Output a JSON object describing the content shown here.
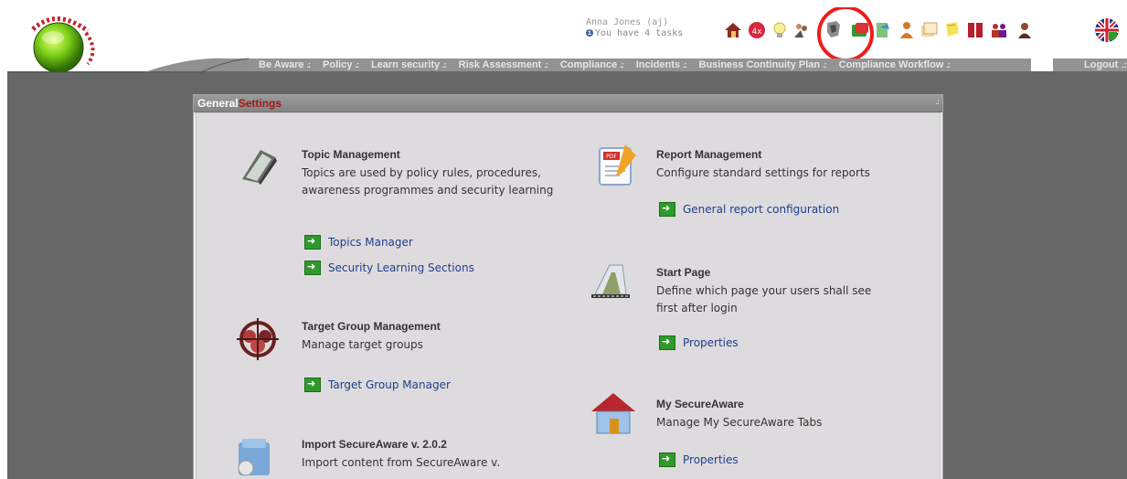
{
  "user": {
    "name": "Anna Jones (aj)",
    "tasks": "You have 4 tasks"
  },
  "toolbar_icons": [
    "house-icon",
    "alert-icon",
    "lightbulb-icon",
    "users-icon",
    "shield-icon",
    "folder-icon",
    "document-icon",
    "person-icon",
    "files-icon",
    "note-icon",
    "book-icon",
    "group-icon",
    "person-dark-icon"
  ],
  "nav": {
    "items": [
      "Be Aware",
      "Policy",
      "Learn security",
      "Risk Assessment",
      "Compliance",
      "Incidents",
      "Business Continuity Plan",
      "Compliance Workflow"
    ],
    "separator": ".:",
    "logout": "Logout"
  },
  "panel": {
    "title_prefix": "General",
    "title_accent": "Settings",
    "resize": ".:"
  },
  "sections": {
    "topic": {
      "title": "Topic Management",
      "desc": "Topics are used by policy rules, procedures, awareness programmes and security learning",
      "links": [
        "Topics Manager",
        "Security Learning Sections"
      ]
    },
    "target": {
      "title": "Target Group Management",
      "desc": "Manage target groups",
      "links": [
        "Target Group Manager"
      ]
    },
    "import": {
      "title": "Import SecureAware v. 2.0.2",
      "desc": "Import content from SecureAware v."
    },
    "report": {
      "title": "Report Management",
      "desc": "Configure standard settings for reports",
      "links": [
        "General report configuration"
      ]
    },
    "start": {
      "title": "Start Page",
      "desc": "Define which page your users shall see first after login",
      "links": [
        "Properties"
      ]
    },
    "mysa": {
      "title": "My SecureAware",
      "desc": "Manage My SecureAware Tabs",
      "links": [
        "Properties"
      ]
    }
  },
  "colors": {
    "accent": "#a51515",
    "link": "#1f3e8c",
    "highlight": "#ee1c1c"
  }
}
